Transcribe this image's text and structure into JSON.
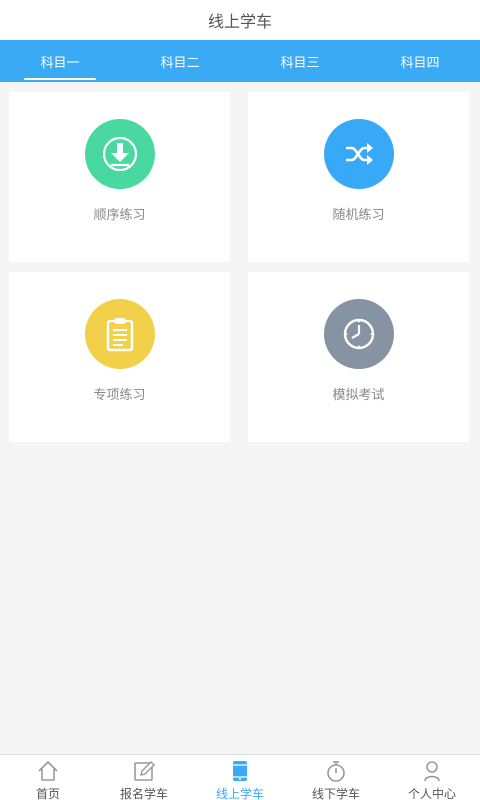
{
  "header": {
    "title": "线上学车"
  },
  "tabs": [
    {
      "label": "科目一",
      "active": true
    },
    {
      "label": "科目二",
      "active": false
    },
    {
      "label": "科目三",
      "active": false
    },
    {
      "label": "科目四",
      "active": false
    }
  ],
  "cards": [
    {
      "label": "顺序练习",
      "icon": "download-icon",
      "color": "#48d8a0"
    },
    {
      "label": "随机练习",
      "icon": "shuffle-icon",
      "color": "#38a9f6"
    },
    {
      "label": "专项练习",
      "icon": "clipboard-icon",
      "color": "#f2d04a"
    },
    {
      "label": "模拟考试",
      "icon": "clock-icon",
      "color": "#8593a3"
    }
  ],
  "bottom_nav": [
    {
      "label": "首页",
      "icon": "home-icon",
      "active": false
    },
    {
      "label": "报名学车",
      "icon": "edit-icon",
      "active": false
    },
    {
      "label": "线上学车",
      "icon": "tablet-icon",
      "active": true
    },
    {
      "label": "线下学车",
      "icon": "stopwatch-icon",
      "active": false
    },
    {
      "label": "个人中心",
      "icon": "user-icon",
      "active": false
    }
  ],
  "colors": {
    "accent": "#3aaaf5",
    "nav_inactive": "#999999"
  }
}
